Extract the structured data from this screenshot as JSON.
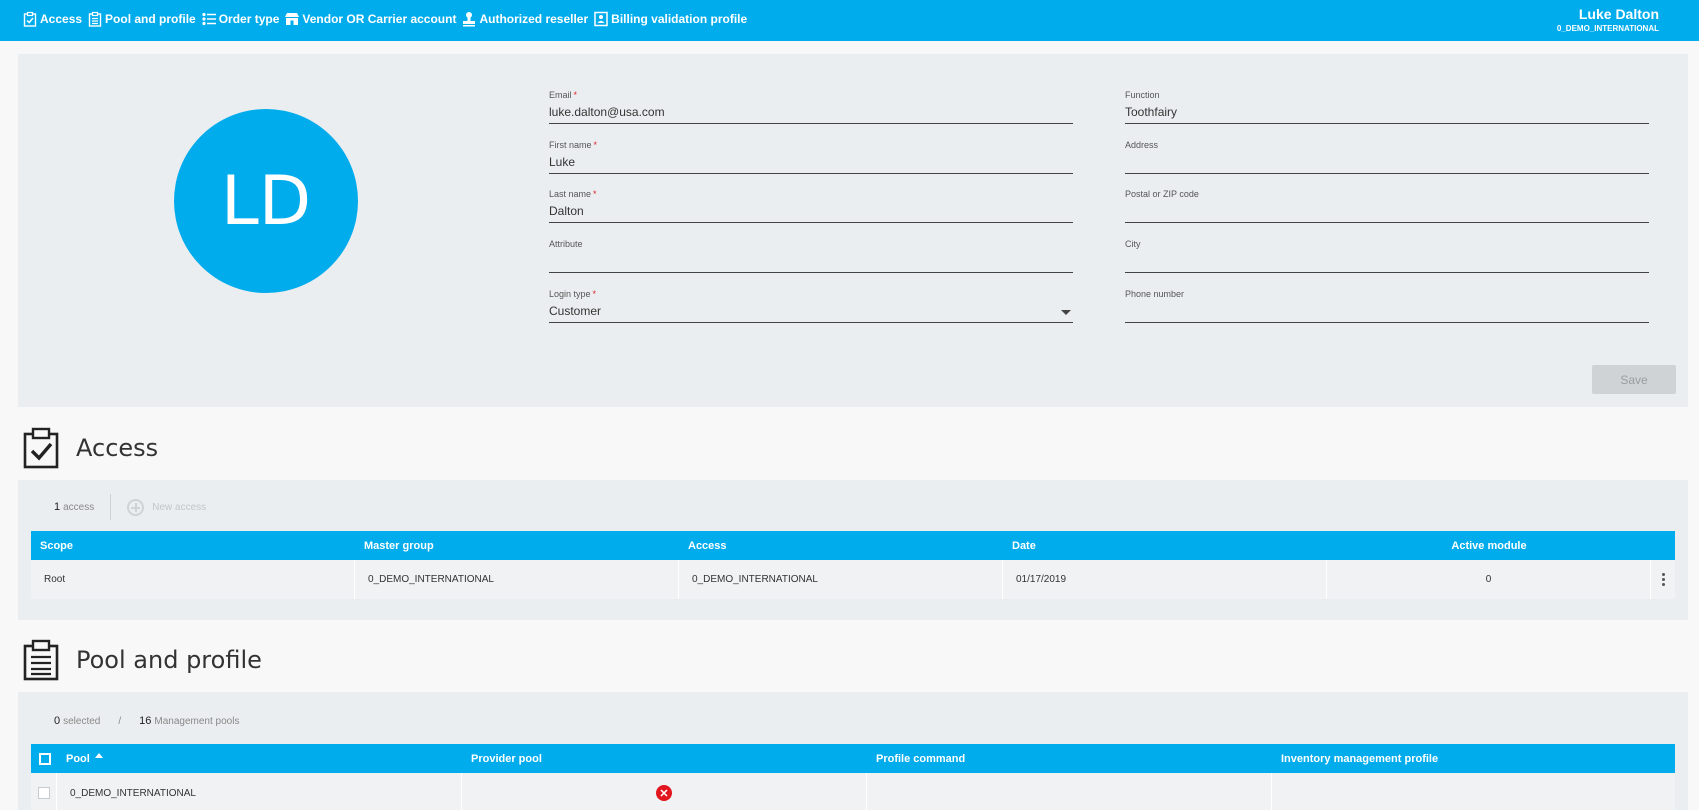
{
  "nav": {
    "items": [
      {
        "label": "Access",
        "icon": "clipboard-check-icon"
      },
      {
        "label": "Pool and profile",
        "icon": "clipboard-list-icon"
      },
      {
        "label": "Order type",
        "icon": "list-icon"
      },
      {
        "label": "Vendor OR Carrier account",
        "icon": "store-icon"
      },
      {
        "label": "Authorized reseller",
        "icon": "stamp-icon"
      },
      {
        "label": "Billing validation profile",
        "icon": "billing-profile-icon"
      }
    ]
  },
  "user": {
    "name": "Luke Dalton",
    "org": "0_DEMO_INTERNATIONAL"
  },
  "profile": {
    "initials": "LD",
    "fields": {
      "email": {
        "label": "Email",
        "required": "*",
        "value": "luke.dalton@usa.com"
      },
      "first_name": {
        "label": "First name",
        "required": "*",
        "value": "Luke"
      },
      "last_name": {
        "label": "Last name",
        "required": "*",
        "value": "Dalton"
      },
      "attribute": {
        "label": "Attribute",
        "value": ""
      },
      "login_type": {
        "label": "Login type",
        "required": "*",
        "value": "Customer"
      },
      "function": {
        "label": "Function",
        "value": "Toothfairy"
      },
      "address": {
        "label": "Address",
        "value": ""
      },
      "postal": {
        "label": "Postal or ZIP code",
        "value": ""
      },
      "city": {
        "label": "City",
        "value": ""
      },
      "phone": {
        "label": "Phone number",
        "value": ""
      }
    },
    "save_label": "Save"
  },
  "access": {
    "title": "Access",
    "count": "1",
    "count_label": "access",
    "new_label": "New access",
    "columns": [
      "Scope",
      "Master group",
      "Access",
      "Date",
      "Active module"
    ],
    "rows": [
      {
        "scope": "Root",
        "master_group": "0_DEMO_INTERNATIONAL",
        "access": "0_DEMO_INTERNATIONAL",
        "date": "01/17/2019",
        "active_module": "0"
      }
    ]
  },
  "pool": {
    "title": "Pool and profile",
    "selected": "0",
    "selected_label": "selected",
    "separator": "/",
    "total": "16",
    "total_label": "Management pools",
    "columns": [
      "Pool",
      "Provider pool",
      "Profile command",
      "Inventory management profile"
    ],
    "rows": [
      {
        "pool": "0_DEMO_INTERNATIONAL",
        "provider_pool": "",
        "profile_command": "",
        "inventory_profile": ""
      }
    ],
    "error_glyph": "✕"
  },
  "colors": {
    "accent": "#00acec",
    "panel": "#ebeef0",
    "error": "#e2161f",
    "required": "#d9262a"
  }
}
